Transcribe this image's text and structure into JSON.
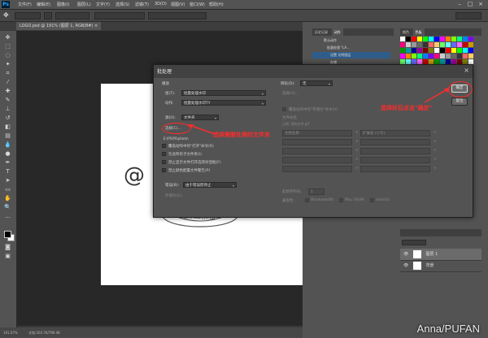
{
  "menubar": {
    "items": [
      "文件(F)",
      "编辑(E)",
      "图像(I)",
      "图层(L)",
      "文字(Y)",
      "选择(S)",
      "滤镜(T)",
      "3D(D)",
      "视图(V)",
      "窗口(W)",
      "帮助(H)"
    ],
    "logo": "Ps"
  },
  "document": {
    "tab_label": "LOGO.psd @ 191% (图层 1, RGB/8#) ×",
    "canvas_text": "@",
    "stamp_text": "anna的拼图"
  },
  "status_bar": {
    "zoom": "191.07%",
    "doc_info": "文档:303.7K/790.4K"
  },
  "history_panel": {
    "tabs": [
      "历史记录",
      "动作"
    ],
    "rows": [
      "默认动作",
      "批量处理 \"LA...",
      "设置 光明图层",
      "存储"
    ]
  },
  "swatches_panel": {
    "tabs": [
      "颜色",
      "色板"
    ]
  },
  "layers_panel": {
    "rows": [
      {
        "name": "图层 1"
      },
      {
        "name": "背景"
      }
    ]
  },
  "dialog": {
    "title": "批处理",
    "play_section": "播放",
    "set_label": "组(T):",
    "set_value": "批量处理水印",
    "action_label": "动作:",
    "action_value": "批量处理水印TY",
    "source_label": "源(O):",
    "source_value": "文件夹",
    "choose_button": "选择(C)...",
    "source_path": "E:\\PS\\PS\\photo\\",
    "options": [
      "覆盖动作中的\"打开\"命令(R)",
      "包含所有子文件夹(I)",
      "禁止显示文件打开选项对话框(F)",
      "禁止颜色配置文件警告(P)"
    ],
    "errors_label": "错误(B):",
    "errors_value": "由于错误而停止",
    "save_as_button": "存储为(E)...",
    "dest_label": "目标(D):",
    "dest_value": "无",
    "dest_choose": "选择(H)...",
    "override_save": "覆盖动作中的\"存储为\"命令(V)",
    "file_naming_title": "文件命名",
    "file_naming_example": "示例: 我的文件.gif",
    "naming_rows": [
      [
        "文档名称",
        "+",
        "扩展名 (小写)",
        "+"
      ],
      [
        "",
        "+",
        "",
        "+"
      ],
      [
        "",
        "+",
        "",
        "+"
      ],
      [
        "",
        "+",
        "",
        "+"
      ],
      [
        "",
        "+",
        "",
        "+"
      ]
    ],
    "start_serial_label": "起始序列号:",
    "start_serial_value": "1",
    "compat_label": "兼容性:",
    "compat_options": [
      "Windows(W)",
      "Mac OS(M)",
      "Unix(U)"
    ],
    "ok_button": "确定",
    "reset_button": "复位"
  },
  "annotations": {
    "callout_folder": "选择需要处理的文件夹",
    "callout_ok": "选择好后点击\"确定\""
  },
  "watermark": "Anna/PUFAN",
  "colors": {
    "accent_red": "#ff2b2b",
    "selection_blue": "#2f5d8b"
  }
}
